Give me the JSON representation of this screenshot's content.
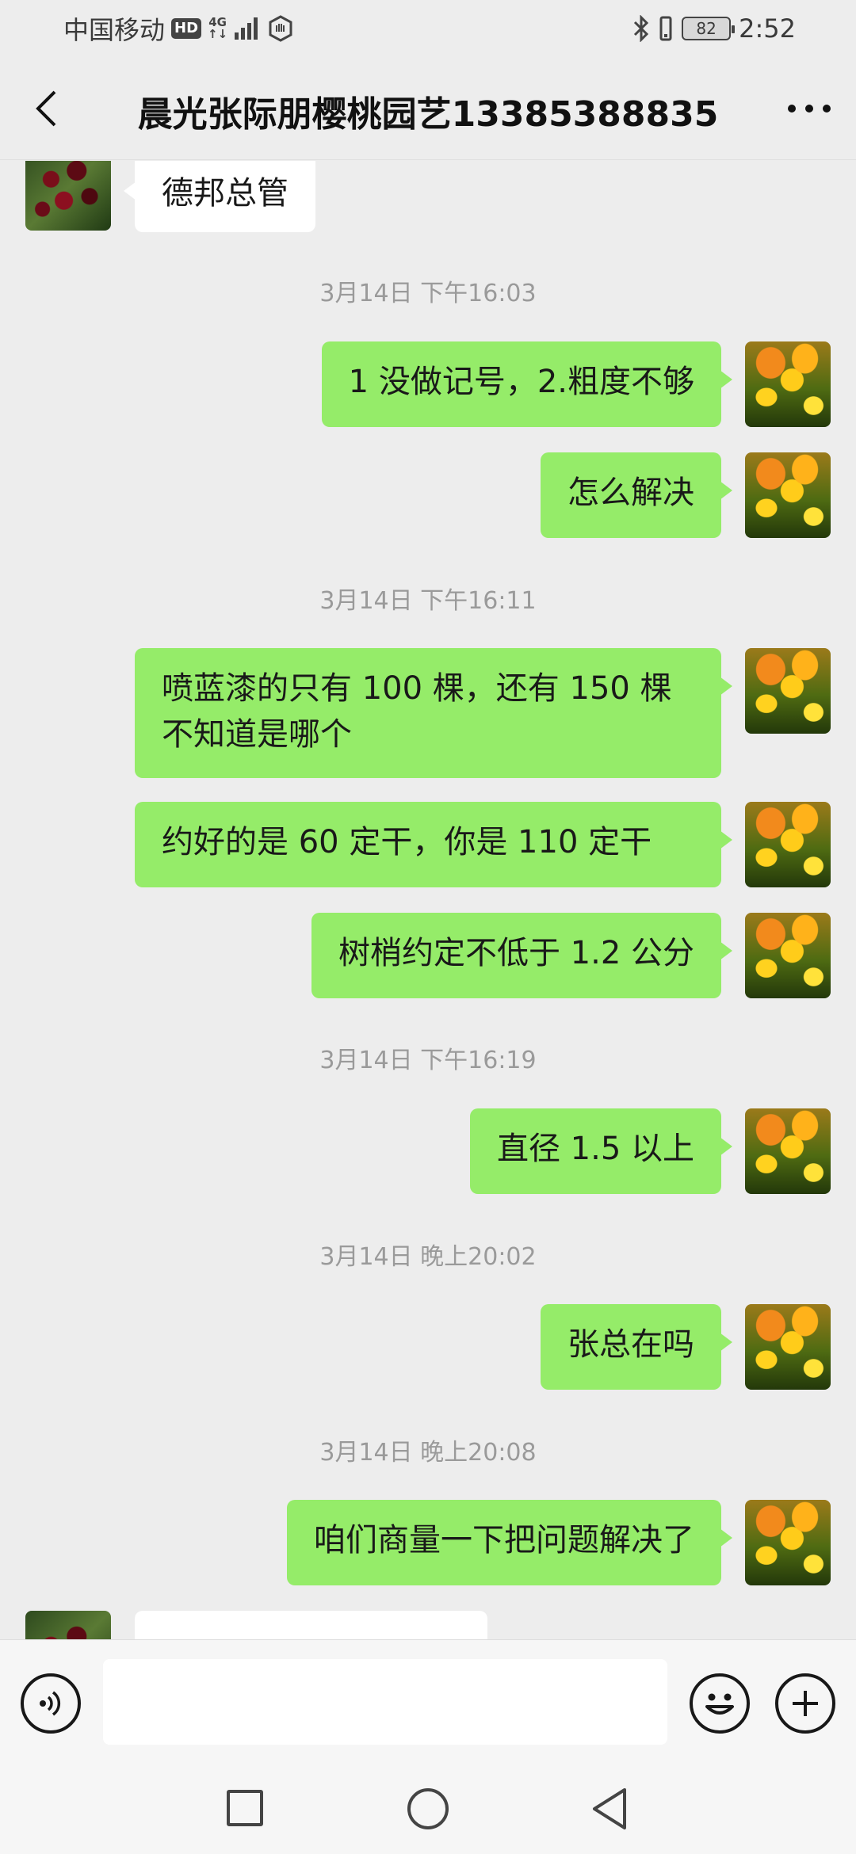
{
  "status_bar": {
    "carrier": "中国移动",
    "hd": "HD",
    "network_top": "4G",
    "network_bottom": "↑↓",
    "battery": "82",
    "time": "2:52"
  },
  "header": {
    "title": "晨光张际朋樱桃园艺13385388835",
    "back_icon": "chevron-left-icon",
    "more_icon": "more-dots-icon"
  },
  "messages": {
    "m0": {
      "sender": "them",
      "text": "德邦总管"
    },
    "t1": "3月14日 下午16:03",
    "m1": {
      "sender": "me",
      "text": "1 没做记号，2.粗度不够"
    },
    "m2": {
      "sender": "me",
      "text": "怎么解决"
    },
    "t2": "3月14日 下午16:11",
    "m3": {
      "sender": "me",
      "line1": "喷蓝漆的只有 100 棵，还有 150 棵",
      "line2": "不知道是哪个"
    },
    "m4": {
      "sender": "me",
      "text": "约好的是 60 定干，你是 110 定干"
    },
    "m5": {
      "sender": "me",
      "text": "树梢约定不低于 1.2 公分"
    },
    "t3": "3月14日 下午16:19",
    "m6": {
      "sender": "me",
      "text": "直径 1.5 以上"
    },
    "t4": "3月14日 晚上20:02",
    "m7": {
      "sender": "me",
      "text": "张总在吗"
    },
    "t5": "3月14日 晚上20:08",
    "m8": {
      "sender": "me",
      "text": "咱们商量一下把问题解决了"
    }
  },
  "avatars": {
    "them": "cherry-avatar",
    "me": "tulip-avatar"
  },
  "input_bar": {
    "voice_icon": "voice-icon",
    "emoji_icon": "emoji-icon",
    "plus_icon": "plus-icon",
    "text_value": ""
  },
  "nav_bar": {
    "recent_icon": "square-icon",
    "home_icon": "circle-icon",
    "back_icon": "triangle-back-icon"
  }
}
